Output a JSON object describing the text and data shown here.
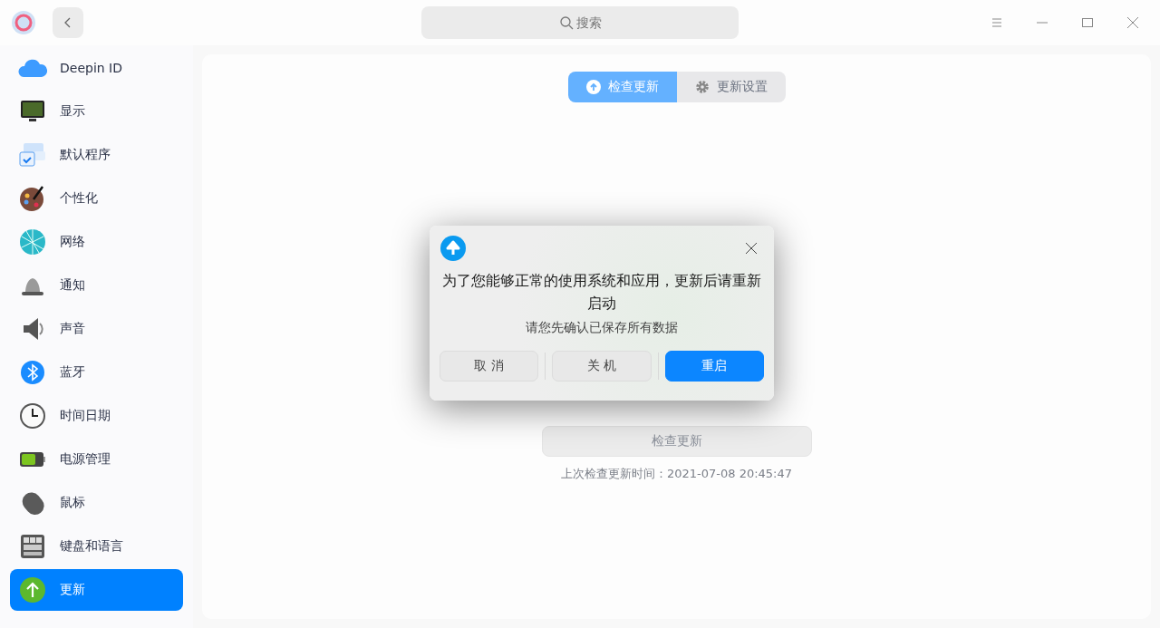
{
  "titlebar": {
    "search": {
      "placeholder": "搜索"
    }
  },
  "sidebar": {
    "items": [
      {
        "label": "Deepin ID",
        "selected": false
      },
      {
        "label": "显示",
        "selected": false
      },
      {
        "label": "默认程序",
        "selected": false
      },
      {
        "label": "个性化",
        "selected": false
      },
      {
        "label": "网络",
        "selected": false
      },
      {
        "label": "通知",
        "selected": false
      },
      {
        "label": "声音",
        "selected": false
      },
      {
        "label": "蓝牙",
        "selected": false
      },
      {
        "label": "时间日期",
        "selected": false
      },
      {
        "label": "电源管理",
        "selected": false
      },
      {
        "label": "鼠标",
        "selected": false
      },
      {
        "label": "键盘和语言",
        "selected": false
      },
      {
        "label": "更新",
        "selected": true
      }
    ]
  },
  "tabs": [
    {
      "label": "检查更新",
      "selected": true
    },
    {
      "label": "更新设置",
      "selected": false
    }
  ],
  "check_button": {
    "label": "检查更新",
    "disabled": true
  },
  "last_check": "上次检查更新时间：2021-07-08 20:45:47",
  "dialog": {
    "message": "为了您能够正常的使用系统和应用，更新后请重新启动",
    "note": "请您先确认已保存所有数据",
    "buttons": [
      {
        "label": "取 消",
        "primary": false
      },
      {
        "label": "关 机",
        "primary": false
      },
      {
        "label": "重启",
        "primary": true
      }
    ]
  }
}
